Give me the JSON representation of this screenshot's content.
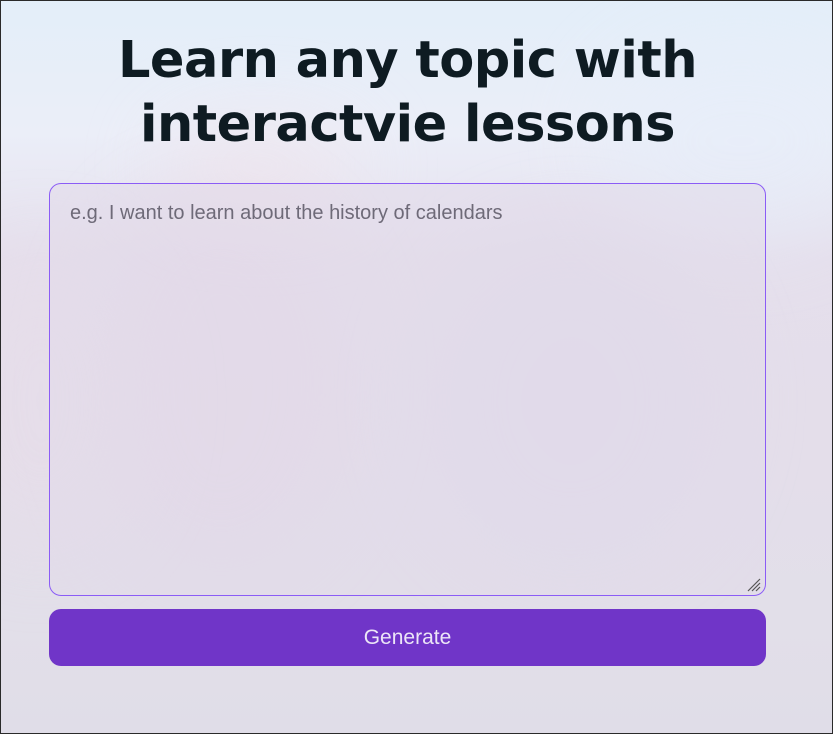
{
  "page": {
    "title_line1": "Learn any topic with",
    "title_line2": "interactvie lessons"
  },
  "prompt": {
    "value": "",
    "placeholder": "e.g. I want to learn about the history of calendars"
  },
  "actions": {
    "generate_label": "Generate"
  },
  "colors": {
    "accent": "#8b5cf6",
    "button": "#7035c8",
    "title": "#0e1b22"
  }
}
